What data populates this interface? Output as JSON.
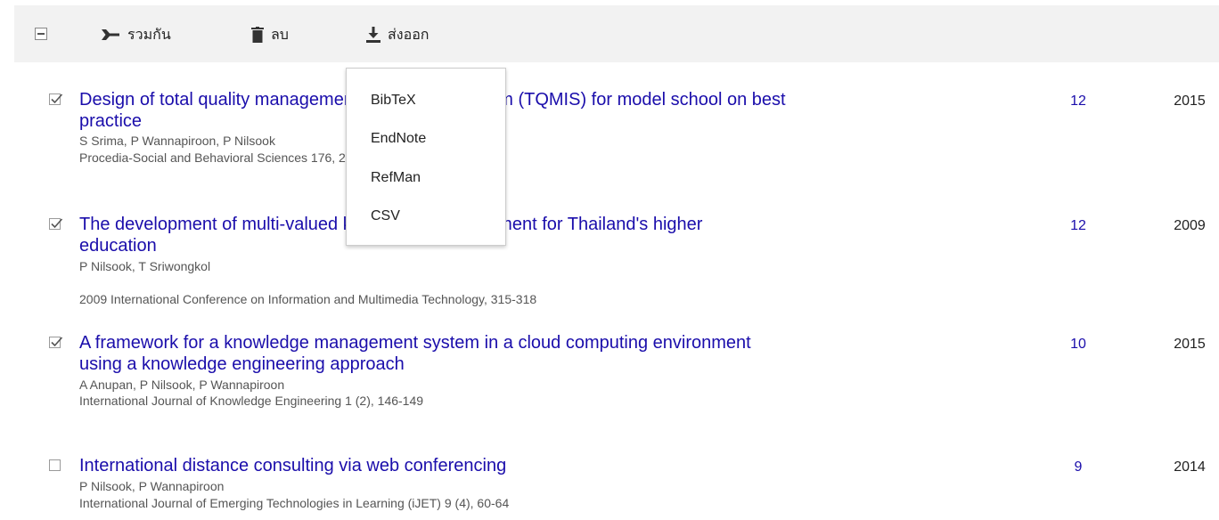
{
  "toolbar": {
    "merge_label": "รวมกัน",
    "delete_label": "ลบ",
    "export_label": "ส่งออก"
  },
  "export_menu": {
    "items": [
      "BibTeX",
      "EndNote",
      "RefMan",
      "CSV"
    ]
  },
  "articles": [
    {
      "checked": true,
      "title_line1": "Design of total quality management information system (TQMIS) for model school on best",
      "title_line2": "practice",
      "authors": "S Srima, P Wannapiroon, P Nilsook",
      "venue": "Procedia-Social and Behavioral Sciences 176, 2160-2165",
      "cited_by": "12",
      "year": "2015"
    },
    {
      "checked": true,
      "title_line1": "The development of multi-valued knowledge management for Thailand's higher",
      "title_line2": "education",
      "authors": "P Nilsook, T Sriwongkol",
      "venue": "2009 International Conference on Information and Multimedia Technology, 315-318",
      "cited_by": "12",
      "year": "2009"
    },
    {
      "checked": true,
      "title_line1": "A framework for a knowledge management system in a cloud computing environment",
      "title_line2": "using a knowledge engineering approach",
      "authors": "A Anupan, P Nilsook, P Wannapiroon",
      "venue": "International Journal of Knowledge Engineering 1 (2), 146-149",
      "cited_by": "10",
      "year": "2015"
    },
    {
      "checked": false,
      "title_line1": "International distance consulting via web conferencing",
      "title_line2": "",
      "authors": "P Nilsook, P Wannapiroon",
      "venue": "International Journal of Emerging Technologies in Learning (iJET) 9 (4), 60-64",
      "cited_by": "9",
      "year": "2014"
    }
  ]
}
